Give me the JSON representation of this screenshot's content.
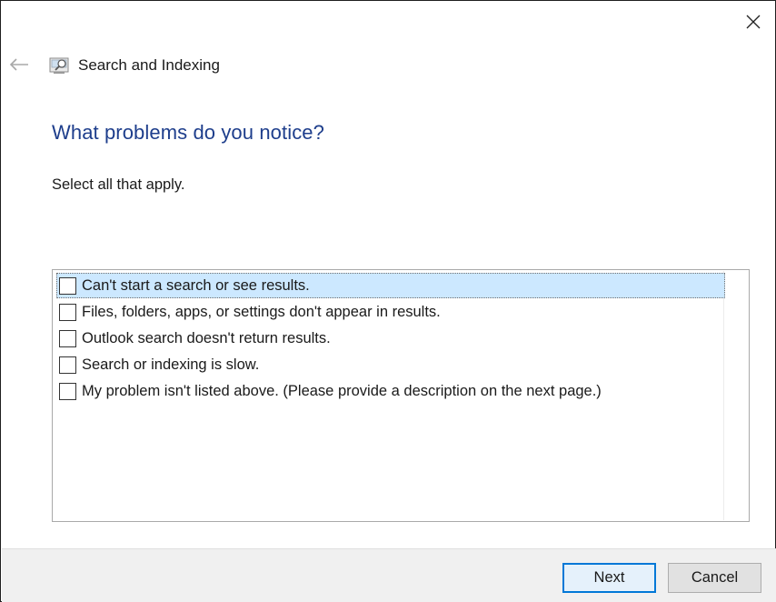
{
  "window": {
    "title": "Search and Indexing",
    "icons": {
      "close": "close-icon",
      "back": "back-arrow-icon",
      "app": "search-indexing-icon"
    }
  },
  "page": {
    "heading": "What problems do you notice?",
    "subheading": "Select all that apply."
  },
  "problems": {
    "items": [
      {
        "label": "Can't start a search or see results.",
        "checked": false,
        "selected": true
      },
      {
        "label": "Files, folders, apps, or settings don't appear in results.",
        "checked": false,
        "selected": false
      },
      {
        "label": "Outlook search doesn't return results.",
        "checked": false,
        "selected": false
      },
      {
        "label": "Search or indexing is slow.",
        "checked": false,
        "selected": false
      },
      {
        "label": "My problem isn't listed above. (Please provide a description on the next page.)",
        "checked": false,
        "selected": false
      }
    ]
  },
  "footer": {
    "next_label": "Next",
    "cancel_label": "Cancel"
  },
  "colors": {
    "heading": "#1e3e8c",
    "selection": "#cce8ff",
    "primary_border": "#0078d7"
  }
}
